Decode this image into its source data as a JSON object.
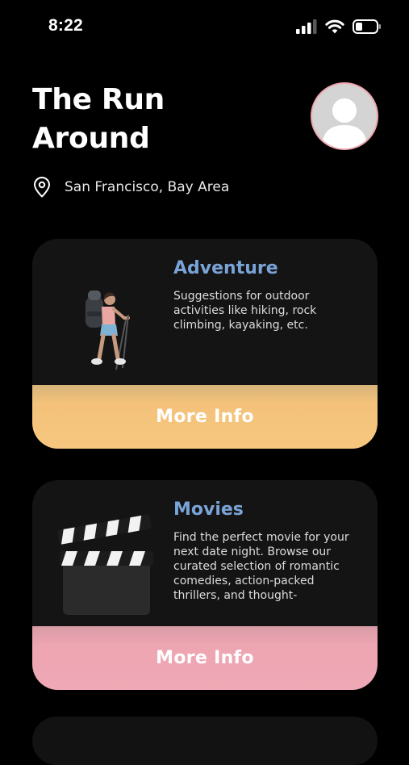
{
  "status_bar": {
    "time": "8:22"
  },
  "header": {
    "title": "The Run Around",
    "location": "San Francisco, Bay Area"
  },
  "cards": [
    {
      "title": "Adventure",
      "description": "Suggestions for outdoor activities like hiking, rock climbing, kayaking, etc.",
      "button_label": "More Info",
      "button_color": "#f7c77f",
      "image": "hiker-illustration"
    },
    {
      "title": "Movies",
      "description": "Find the perfect movie for your next date night. Browse our curated selection of romantic comedies, action-packed thrillers, and thought-",
      "button_label": "More Info",
      "button_color": "#efa8b5",
      "image": "clapperboard-illustration"
    }
  ],
  "colors": {
    "background": "#000000",
    "card_background": "#141414",
    "card_title": "#7aa3d8",
    "avatar_border": "#f0a6b0"
  },
  "icons": {
    "location": "map-pin-icon",
    "avatar": "user-placeholder-icon",
    "signal": "cellular-signal-icon",
    "wifi": "wifi-icon",
    "battery": "battery-icon"
  }
}
